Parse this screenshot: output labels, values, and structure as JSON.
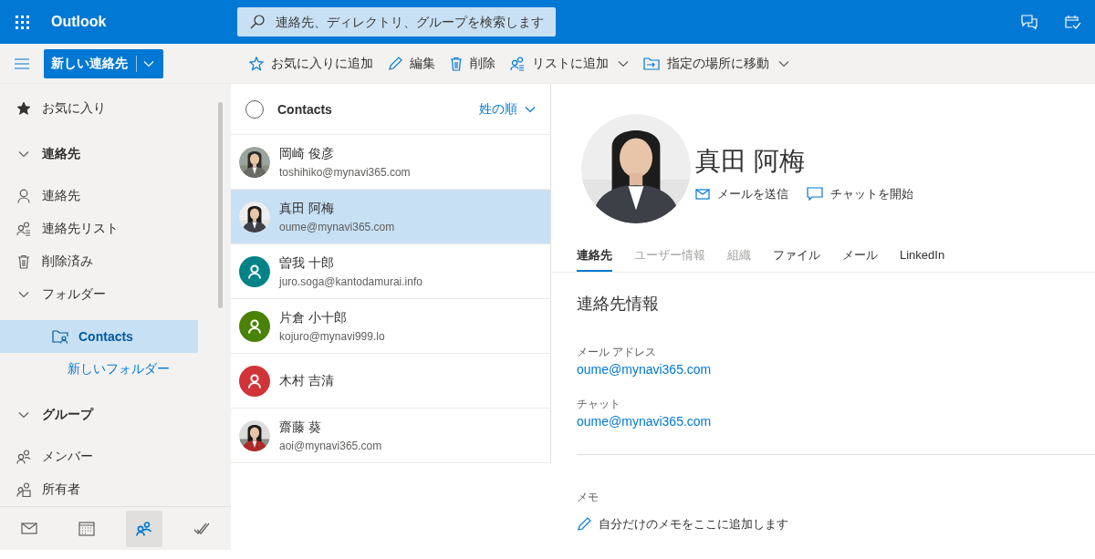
{
  "app": {
    "name": "Outlook"
  },
  "search": {
    "placeholder": "連絡先、ディレクトリ、グループを検索します"
  },
  "toolbar": {
    "new_button": "新しい連絡先",
    "actions": [
      {
        "label": "お気に入りに追加",
        "dropdown": false
      },
      {
        "label": "編集",
        "dropdown": false
      },
      {
        "label": "削除",
        "dropdown": false
      },
      {
        "label": "リストに追加",
        "dropdown": true
      },
      {
        "label": "指定の場所に移動",
        "dropdown": true
      }
    ]
  },
  "sidebar": {
    "items": [
      {
        "kind": "favorite",
        "label": "お気に入り",
        "selected": false
      },
      {
        "kind": "section",
        "label": "連絡先",
        "expanded": true,
        "children": [
          {
            "kind": "item",
            "label": "連絡先",
            "selected": false
          },
          {
            "kind": "item",
            "label": "連絡先リスト",
            "selected": false
          },
          {
            "kind": "item",
            "label": "削除済み",
            "selected": false
          },
          {
            "kind": "section",
            "label": "フォルダー",
            "expanded": true,
            "children": [
              {
                "kind": "folder",
                "label": "Contacts",
                "selected": true
              },
              {
                "kind": "link",
                "label": "新しいフォルダー",
                "selected": false
              }
            ]
          }
        ]
      },
      {
        "kind": "section",
        "label": "グループ",
        "expanded": true,
        "children": [
          {
            "kind": "item",
            "label": "メンバー",
            "selected": false
          },
          {
            "kind": "item",
            "label": "所有者",
            "selected": false
          }
        ]
      }
    ]
  },
  "bottom_nav": [
    {
      "selected": false
    },
    {
      "selected": false
    },
    {
      "selected": true
    },
    {
      "selected": false
    }
  ],
  "list": {
    "all_selected": false,
    "title": "Contacts",
    "sort": "姓の順",
    "contacts": [
      {
        "name": "岡崎 俊彦",
        "email": "toshihiko@mynavi365.com",
        "selected": false
      },
      {
        "name": "真田 阿梅",
        "email": "oume@mynavi365.com",
        "selected": true
      },
      {
        "name": "曽我 十郎",
        "email": "juro.soga@kantodamurai.info",
        "avatar": {
          "kind": "placeholder",
          "color": "#038387"
        },
        "selected": false
      },
      {
        "name": "片倉 小十郎",
        "email": "kojuro@mynavi999.lo",
        "avatar": {
          "kind": "placeholder",
          "color": "#498205"
        },
        "selected": false
      },
      {
        "name": "木村 吉清",
        "avatar": {
          "kind": "placeholder",
          "color": "#d13438"
        },
        "selected": false
      },
      {
        "name": "齋藤 葵",
        "email": "aoi@mynavi365.com",
        "selected": false
      }
    ]
  },
  "detail": {
    "name": "真田 阿梅",
    "actions": [
      {
        "label": "メールを送信"
      },
      {
        "label": "チャットを開始"
      }
    ],
    "tabs": [
      {
        "label": "連絡先",
        "selected": true,
        "disabled": false
      },
      {
        "label": "ユーザー情報",
        "selected": false,
        "disabled": true
      },
      {
        "label": "組織",
        "selected": false,
        "disabled": true
      },
      {
        "label": "ファイル",
        "selected": false,
        "disabled": false
      },
      {
        "label": "メール",
        "selected": false,
        "disabled": false
      },
      {
        "label": "LinkedIn",
        "selected": false,
        "disabled": false
      }
    ],
    "section_title": "連絡先情報",
    "fields": [
      {
        "label": "メール アドレス",
        "value": "oume@mynavi365.com"
      },
      {
        "label": "チャット",
        "value": "oume@mynavi365.com"
      }
    ],
    "notes": {
      "label": "メモ",
      "add_note": "自分だけのメモをここに追加します"
    }
  }
}
